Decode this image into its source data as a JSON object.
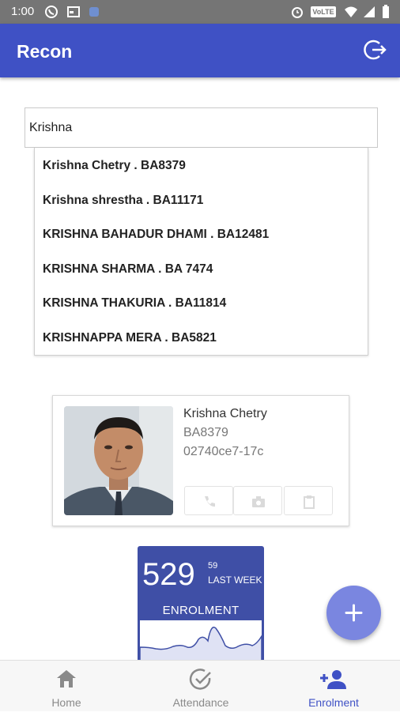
{
  "status_bar": {
    "time": "1:00",
    "network_label": "VoLTE"
  },
  "app_bar": {
    "title": "Recon",
    "logout_icon": "logout-icon"
  },
  "search": {
    "value": "Krishna",
    "placeholder": ""
  },
  "suggestions": [
    "Krishna Chetry . BA8379",
    "Krishna shrestha . BA11171",
    "KRISHNA BAHADUR DHAMI . BA12481",
    "KRISHNA SHARMA . BA 7474",
    "KRISHNA THAKURIA . BA11814",
    "KRISHNAPPA MERA . BA5821"
  ],
  "person_card": {
    "name": "Krishna Chetry",
    "id": "BA8379",
    "code": "02740ce7-17c",
    "actions": [
      "phone-icon",
      "camera-icon",
      "clipboard-icon"
    ]
  },
  "stat_tile": {
    "count": "529",
    "weekly_count": "59",
    "weekly_label": "LAST WEEK",
    "label": "ENROLMENT"
  },
  "fab": {
    "icon": "add-icon"
  },
  "bottom_nav": [
    {
      "label": "Home",
      "icon": "home-icon",
      "active": false
    },
    {
      "label": "Attendance",
      "icon": "check-circle-icon",
      "active": false
    },
    {
      "label": "Enrolment",
      "icon": "add-person-icon",
      "active": true
    }
  ],
  "colors": {
    "primary": "#3f51c5",
    "tile": "#3f4fa6",
    "fab": "#7a86e0",
    "nav_active": "#3f51c5",
    "nav_inactive": "#8a8a8a"
  }
}
